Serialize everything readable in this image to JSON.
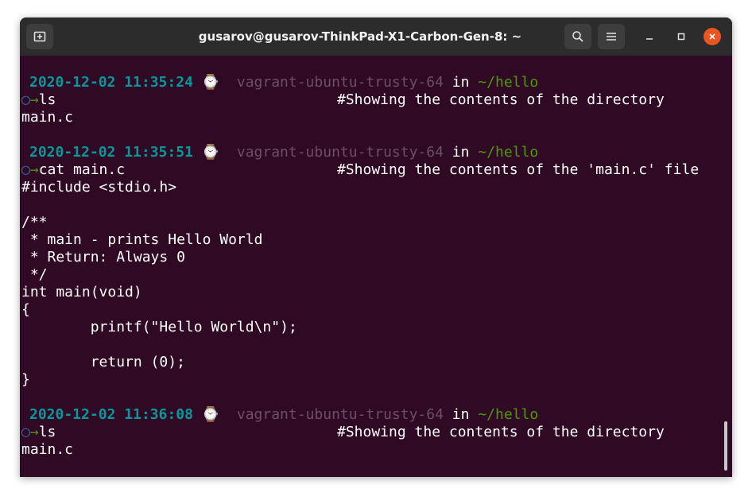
{
  "window": {
    "title": "gusarov@gusarov-ThinkPad-X1-Carbon-Gen-8: ~"
  },
  "titlebar_icons": {
    "new_tab": "new-tab-icon",
    "search": "search-icon",
    "menu": "hamburger-menu-icon",
    "minimize": "minimize-icon",
    "maximize": "maximize-icon",
    "close": "close-icon"
  },
  "colors": {
    "terminal_bg": "#300a24",
    "titlebar_bg": "#2c2c2c",
    "timestamp": "#06989a",
    "host": "#6d4f66",
    "path": "#4e9a06",
    "close": "#e95420"
  },
  "prompt": {
    "clock_icon": "⌚",
    "in_word": "in",
    "circle": "◯",
    "arrow": "→"
  },
  "blocks": [
    {
      "timestamp": "2020-12-02 11:35:24",
      "host": "vagrant-ubuntu-trusty-64",
      "path": "~/hello",
      "command": "ls",
      "comment": "#Showing the contents of the directory",
      "output": [
        "main.c"
      ]
    },
    {
      "timestamp": "2020-12-02 11:35:51",
      "host": "vagrant-ubuntu-trusty-64",
      "path": "~/hello",
      "command": "cat main.c",
      "comment": "#Showing the contents of the 'main.c' file",
      "output": [
        "#include <stdio.h>",
        "",
        "/**",
        " * main - prints Hello World",
        " * Return: Always 0",
        " */",
        "int main(void)",
        "{",
        "        printf(\"Hello World\\n\");",
        "",
        "        return (0);",
        "}"
      ]
    },
    {
      "timestamp": "2020-12-02 11:36:08",
      "host": "vagrant-ubuntu-trusty-64",
      "path": "~/hello",
      "command": "ls",
      "comment": "#Showing the contents of the directory",
      "output": [
        "main.c"
      ]
    }
  ]
}
